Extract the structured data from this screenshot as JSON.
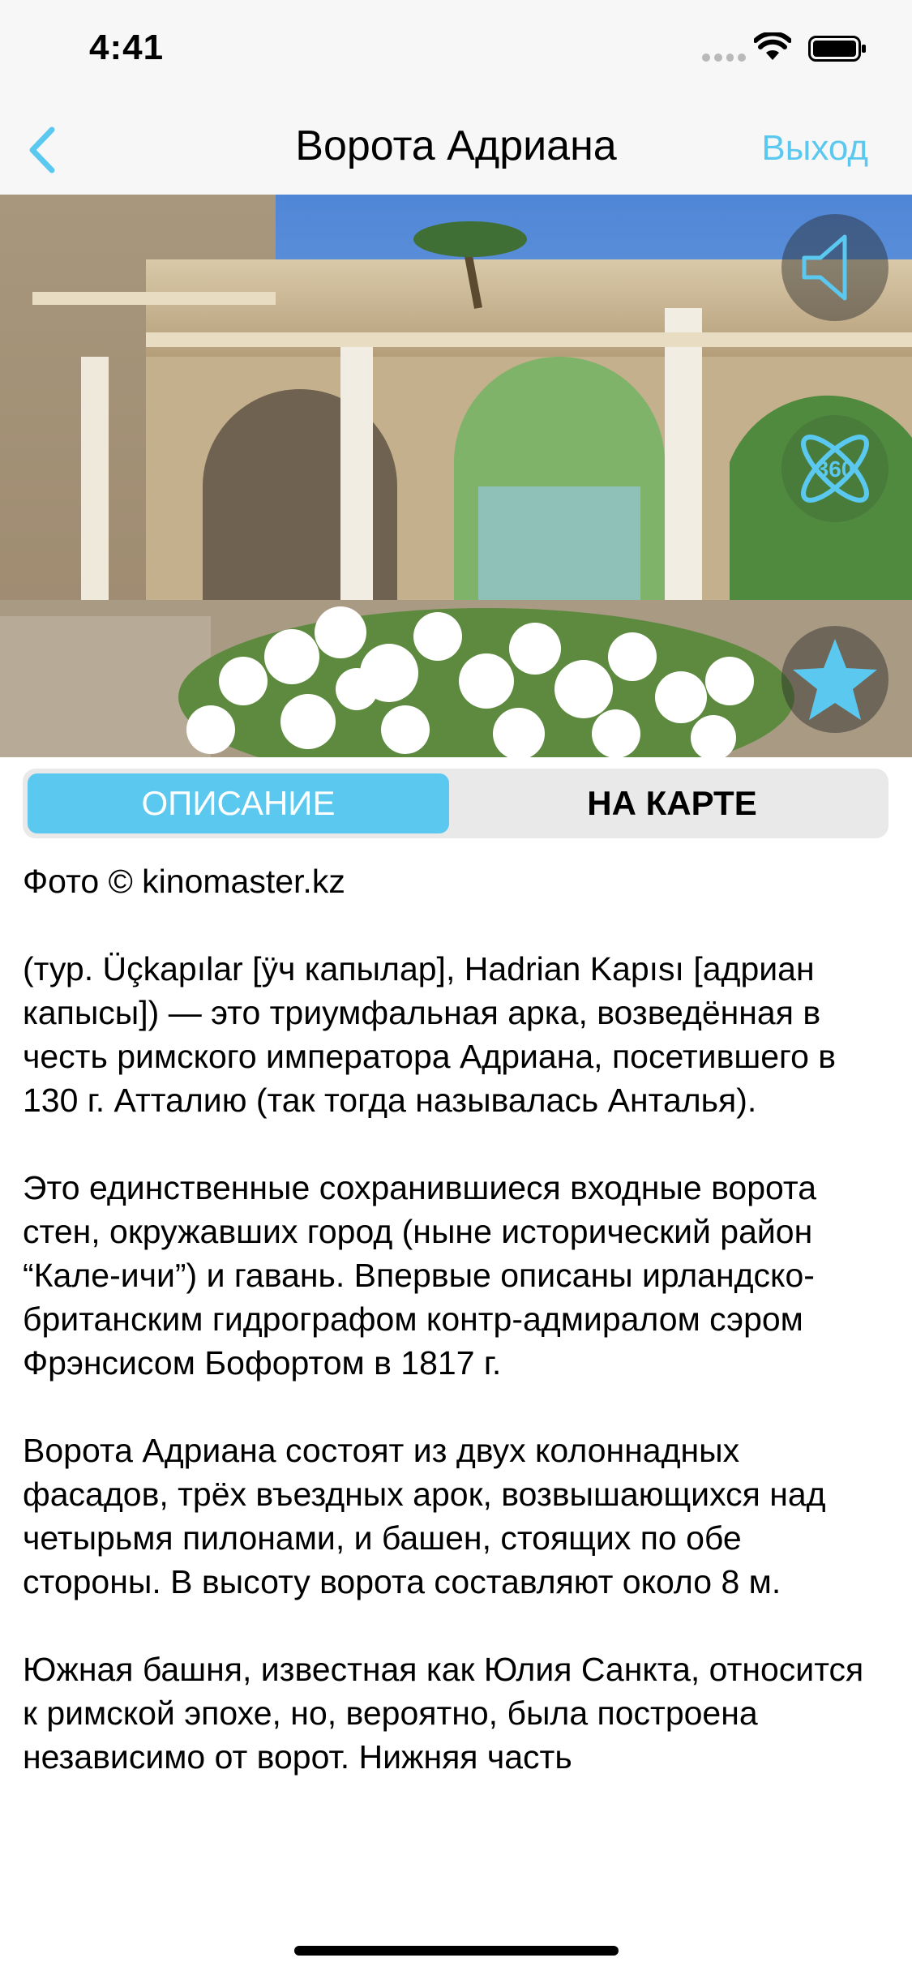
{
  "status": {
    "time": "4:41"
  },
  "nav": {
    "title": "Ворота Адриана",
    "exit_label": "Выход"
  },
  "hero": {
    "fab_360_label": "360"
  },
  "tabs": {
    "description": "ОПИСАНИЕ",
    "map": "НА КАРТЕ"
  },
  "content": {
    "photo_credit": "Фото © kinomaster.kz",
    "p1": "(тур. Üçkapılar [ӱч капылар], Hadrian Kapısı [адриан капысы]) — это триумфальная арка, возведённая в честь римского императора Адриана, посетившего в 130 г. Атталию (так тогда называлась Анталья).",
    "p2": "Это единственные сохранившиеся входные ворота стен, окружавших город (ныне исторический район “Кале-ичи”) и гавань. Впервые описаны ирландско-британским гидрографом контр-адмиралом сэром Фрэнсисом Бофортом в 1817 г.",
    "p3": "Ворота Адриана состоят из двух колоннадных фасадов, трёх въездных арок, возвышающихся над четырьмя пилонами, и башен, стоящих по обе стороны. В высоту ворота составляют около 8 м.",
    "p4": "Южная башня, известная как Юлия Санкта, относится к римской эпохе, но, вероятно, была построена независимо от ворот. Нижняя часть"
  },
  "colors": {
    "accent": "#5bc8ef",
    "bar_background": "#f7f7f7",
    "segment_background": "#e9e9e9"
  }
}
